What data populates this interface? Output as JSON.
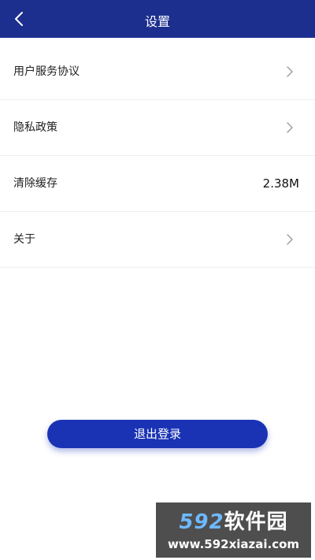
{
  "header": {
    "title": "设置",
    "back_icon": "chevron-left-icon"
  },
  "settings": {
    "items": [
      {
        "label": "用户服务协议",
        "has_chevron": true
      },
      {
        "label": "隐私政策",
        "has_chevron": true
      },
      {
        "label": "清除缓存",
        "value": "2.38M"
      },
      {
        "label": "关于",
        "has_chevron": true
      }
    ]
  },
  "logout": {
    "label": "退出登录"
  },
  "watermark": {
    "number": "592",
    "name": "软件园",
    "url": "www.592xiazai.com"
  },
  "colors": {
    "header_bg": "#1c2f8f",
    "button_bg": "#1a33b5",
    "watermark_bg": "#4e4e4e"
  }
}
